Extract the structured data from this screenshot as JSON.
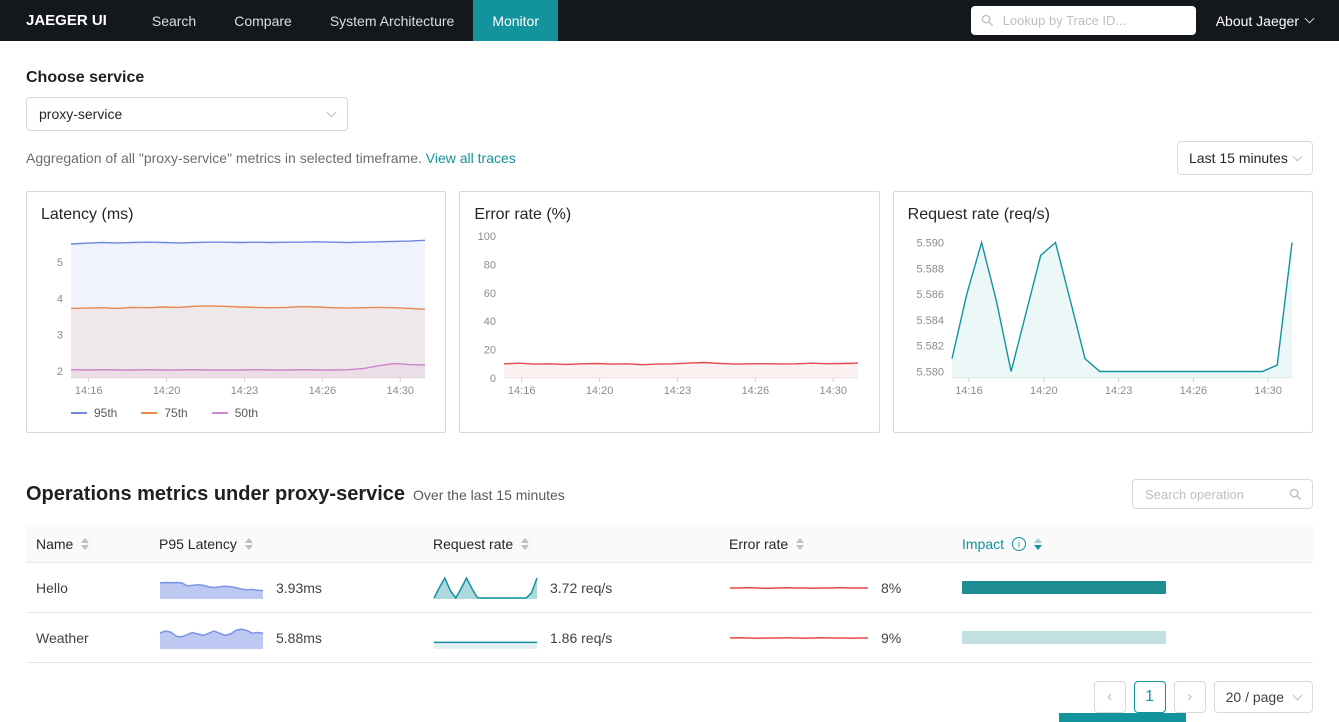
{
  "accent": "#12939e",
  "navbar": {
    "brand": "JAEGER UI",
    "items": [
      {
        "label": "Search"
      },
      {
        "label": "Compare"
      },
      {
        "label": "System Architecture"
      },
      {
        "label": "Monitor"
      }
    ],
    "active_item": "Monitor",
    "trace_search_placeholder": "Lookup by Trace ID...",
    "about_label": "About Jaeger"
  },
  "service_section": {
    "heading": "Choose service",
    "selected_service": "proxy-service",
    "aggregation_text": "Aggregation of all \"proxy-service\" metrics in selected timeframe.",
    "view_all_traces_label": "View all traces",
    "timeframe_label": "Last 15 minutes"
  },
  "chart_data": {
    "latency": {
      "type": "line",
      "title": "Latency (ms)",
      "ylim": [
        1.8,
        5.72
      ],
      "ml": 30,
      "y_ticks": [
        {
          "value": 2,
          "label": "2"
        },
        {
          "value": 3,
          "label": "3"
        },
        {
          "value": 4,
          "label": "4"
        },
        {
          "value": 5,
          "label": "5"
        }
      ],
      "x_ticks": [
        "14:16",
        "14:20",
        "14:23",
        "14:26",
        "14:30"
      ],
      "series": [
        {
          "name": "95th",
          "color": "#7086e0",
          "fill": "rgba(112,134,224,0.10)",
          "values": [
            5.5,
            5.52,
            5.54,
            5.53,
            5.54,
            5.55,
            5.54,
            5.53,
            5.54,
            5.55,
            5.55,
            5.54,
            5.55,
            5.54,
            5.55,
            5.55,
            5.56,
            5.55,
            5.54,
            5.55,
            5.56,
            5.57,
            5.58,
            5.6
          ]
        },
        {
          "name": "75th",
          "color": "#e8884f",
          "fill": "rgba(232,136,79,0.10)",
          "values": [
            3.72,
            3.73,
            3.74,
            3.72,
            3.75,
            3.74,
            3.76,
            3.75,
            3.78,
            3.79,
            3.78,
            3.76,
            3.75,
            3.74,
            3.75,
            3.77,
            3.76,
            3.74,
            3.73,
            3.74,
            3.75,
            3.74,
            3.72,
            3.7
          ]
        },
        {
          "name": "50th",
          "color": "#cd85cd",
          "fill": "rgba(205,133,205,0.10)",
          "values": [
            2.03,
            2.02,
            2.03,
            2.02,
            2.02,
            2.03,
            2.02,
            2.02,
            2.03,
            2.02,
            2.02,
            2.02,
            2.03,
            2.02,
            2.02,
            2.03,
            2.02,
            2.02,
            2.03,
            2.06,
            2.14,
            2.2,
            2.17,
            2.16
          ]
        }
      ]
    },
    "error_rate": {
      "type": "line",
      "title": "Error rate (%)",
      "ylim": [
        0,
        100
      ],
      "ml": 30,
      "y_ticks": [
        {
          "value": 0,
          "label": "0"
        },
        {
          "value": 20,
          "label": "20"
        },
        {
          "value": 40,
          "label": "40"
        },
        {
          "value": 60,
          "label": "60"
        },
        {
          "value": 80,
          "label": "80"
        },
        {
          "value": 100,
          "label": "100"
        }
      ],
      "x_ticks": [
        "14:16",
        "14:20",
        "14:23",
        "14:26",
        "14:30"
      ],
      "series": [
        {
          "name": "error rate",
          "color": "#e5484d",
          "fill": "rgba(229,72,77,0.08)",
          "values": [
            10,
            10.4,
            9.8,
            10,
            9.6,
            10,
            10.2,
            9.8,
            10,
            9.4,
            9.8,
            10,
            10.5,
            10.9,
            10.3,
            9.8,
            10,
            10.1,
            9.9,
            10,
            10.4,
            10.1,
            10.2,
            10.5
          ]
        }
      ]
    },
    "request_rate": {
      "type": "line",
      "title": "Request rate (req/s)",
      "ylim": [
        5.5795,
        5.5905
      ],
      "ml": 44,
      "y_ticks": [
        {
          "value": 5.58,
          "label": "5.580"
        },
        {
          "value": 5.582,
          "label": "5.582"
        },
        {
          "value": 5.584,
          "label": "5.584"
        },
        {
          "value": 5.586,
          "label": "5.586"
        },
        {
          "value": 5.588,
          "label": "5.588"
        },
        {
          "value": 5.59,
          "label": "5.590"
        }
      ],
      "x_ticks": [
        "14:16",
        "14:20",
        "14:23",
        "14:26",
        "14:30"
      ],
      "series": [
        {
          "name": "request rate",
          "color": "#12939e",
          "fill": "rgba(18,147,158,0.08)",
          "values": [
            5.581,
            5.586,
            5.59,
            5.5855,
            5.58,
            5.5845,
            5.589,
            5.59,
            5.5855,
            5.581,
            5.58,
            5.58,
            5.58,
            5.58,
            5.58,
            5.58,
            5.58,
            5.58,
            5.58,
            5.58,
            5.58,
            5.58,
            5.5805,
            5.59
          ]
        }
      ]
    }
  },
  "operations": {
    "title": "Operations metrics under proxy-service",
    "subtitle": "Over the last 15 minutes",
    "search_placeholder": "Search operation",
    "columns": [
      {
        "label": "Name"
      },
      {
        "label": "P95 Latency"
      },
      {
        "label": "Request rate"
      },
      {
        "label": "Error rate"
      },
      {
        "label": "Impact"
      }
    ],
    "rows": [
      {
        "name": "Hello",
        "p95_latency": "3.93ms",
        "request_rate": "3.72 req/s",
        "error_rate": "8%",
        "latency_spark": {
          "ylim": [
            0,
            6
          ],
          "series": [
            {
              "color": "#7b93e8",
              "fill": "rgba(123,147,232,0.5)",
              "width": 1.5,
              "values": [
                4.4,
                4.5,
                4.42,
                4.5,
                4.38,
                3.6,
                3.72,
                3.9,
                3.72,
                3.3,
                3.1,
                3.3,
                3.5,
                3.36,
                3.12,
                2.7,
                2.5,
                2.6,
                2.4,
                2.3
              ]
            }
          ]
        },
        "request_spark": {
          "ylim": [
            0,
            1.05
          ],
          "series": [
            {
              "color": "#12939e",
              "fill": "rgba(18,147,158,0.35)",
              "width": 1.5,
              "values": [
                0.05,
                0.55,
                1,
                0.4,
                0.05,
                0.5,
                1,
                0.5,
                0.06,
                0.05,
                0.05,
                0.05,
                0.05,
                0.05,
                0.05,
                0.05,
                0.05,
                0.05,
                0.3,
                1
              ]
            }
          ]
        },
        "error_spark": {
          "ylim": [
            0,
            1
          ],
          "series": [
            {
              "color": "#e5484d",
              "width": 1.5,
              "values": [
                0.5,
                0.5,
                0.53,
                0.5,
                0.47,
                0.5,
                0.52,
                0.5,
                0.5,
                0.48,
                0.5,
                0.5,
                0.53,
                0.5,
                0.5,
                0.5
              ]
            }
          ]
        },
        "impact": {
          "color": "#1d8d93",
          "width_pct": 100
        }
      },
      {
        "name": "Weather",
        "p95_latency": "5.88ms",
        "request_rate": "1.86 req/s",
        "error_rate": "9%",
        "latency_spark": {
          "ylim": [
            0,
            6
          ],
          "series": [
            {
              "color": "#7b93e8",
              "fill": "rgba(123,147,232,0.5)",
              "width": 1.5,
              "values": [
                4.4,
                4.9,
                4.6,
                3.5,
                3.3,
                3.9,
                4.5,
                4.1,
                3.7,
                4.3,
                4.9,
                4.3,
                3.7,
                4.1,
                5.1,
                5.4,
                5.1,
                4.3,
                4.5,
                4.3
              ]
            }
          ]
        },
        "request_spark": {
          "ylim": [
            0,
            1
          ],
          "series": [
            {
              "color": "#12939e",
              "fill": "rgba(18,147,158,0.12)",
              "width": 1.5,
              "values": [
                0.3,
                0.3,
                0.3,
                0.3,
                0.3,
                0.3,
                0.3,
                0.3,
                0.3,
                0.3,
                0.3,
                0.3,
                0.3,
                0.3,
                0.3,
                0.3,
                0.3,
                0.3,
                0.3,
                0.3
              ]
            }
          ]
        },
        "error_spark": {
          "ylim": [
            0,
            1
          ],
          "series": [
            {
              "color": "#e5484d",
              "width": 1.5,
              "values": [
                0.5,
                0.52,
                0.5,
                0.48,
                0.5,
                0.5,
                0.51,
                0.5,
                0.49,
                0.5,
                0.52,
                0.5,
                0.5,
                0.49,
                0.5,
                0.5
              ]
            }
          ]
        },
        "impact": {
          "color": "#c2dfe1",
          "width_pct": 100
        }
      }
    ]
  },
  "pagination": {
    "prev_label": "‹",
    "current_page": "1",
    "next_label": "›",
    "page_size_label": "20 / page"
  }
}
